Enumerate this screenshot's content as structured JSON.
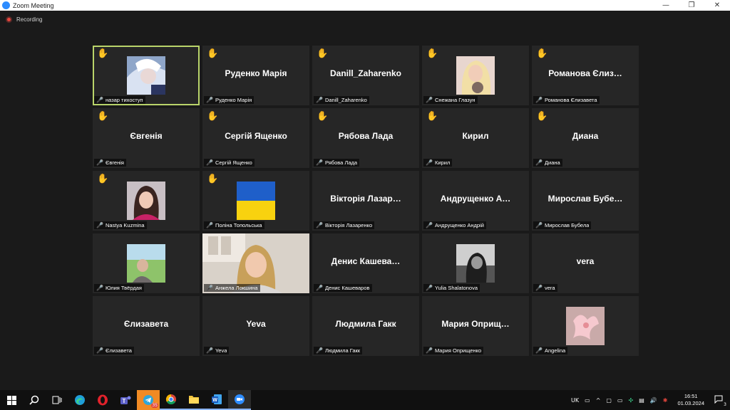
{
  "window": {
    "title": "Zoom Meeting",
    "controls": [
      "—",
      "❐",
      "✕"
    ]
  },
  "recording": {
    "label": "Recording"
  },
  "tiles": [
    {
      "big": "",
      "name": "назар тихоступ",
      "hand": true,
      "avatar": "anime-avatar",
      "active": true
    },
    {
      "big": "Руденко Марія",
      "name": "Руденко Марія",
      "hand": true
    },
    {
      "big": "Danill_Zaharenko",
      "name": "Danill_Zaharenko",
      "hand": true
    },
    {
      "big": "",
      "name": "Снежана Глазун",
      "hand": true,
      "avatar": "photo-blonde"
    },
    {
      "big": "Романова Єлиз…",
      "name": "Романова Єлизавета",
      "hand": true
    },
    {
      "big": "Євгенія",
      "name": "Євгенія",
      "hand": true
    },
    {
      "big": "Сергій Ященко",
      "name": "Сергій Ященко",
      "hand": true
    },
    {
      "big": "Рябова Лада",
      "name": "Рябова Лада",
      "hand": true
    },
    {
      "big": "Кирил",
      "name": "Кирил",
      "hand": true
    },
    {
      "big": "Диана",
      "name": "Диана",
      "hand": true
    },
    {
      "big": "",
      "name": "Nastya Kuzmina",
      "hand": true,
      "avatar": "photo-girl"
    },
    {
      "big": "",
      "name": "Поліна Топольська",
      "hand": true,
      "avatar": "ukraine-flag"
    },
    {
      "big": "Вікторія Лазар…",
      "name": "Вікторія Лазаренко",
      "hand": false
    },
    {
      "big": "Андрущенко А…",
      "name": "Андрущенко Андрій",
      "hand": false
    },
    {
      "big": "Мирослав Бубе…",
      "name": "Мирослав Бубела",
      "hand": false
    },
    {
      "big": "",
      "name": "Юлия Твёрдая",
      "hand": false,
      "avatar": "photo-outdoor"
    },
    {
      "big": "",
      "name": "Анжела Локшина",
      "hand": false,
      "avatar": "video-woman"
    },
    {
      "big": "Денис Кашева…",
      "name": "Денис Кашеваров",
      "hand": false
    },
    {
      "big": "",
      "name": "Yulia Shalatonova",
      "hand": false,
      "avatar": "photo-bw"
    },
    {
      "big": "vera",
      "name": "vera",
      "hand": false
    },
    {
      "big": "Єлизавета",
      "name": "Єлизавета",
      "hand": false
    },
    {
      "big": "Yeva",
      "name": "Yeva",
      "hand": false
    },
    {
      "big": "Людмила Гакк",
      "name": "Людмила Гакк",
      "hand": false
    },
    {
      "big": "Мария Оприщ…",
      "name": "Мария Оприщенко",
      "hand": false
    },
    {
      "big": "",
      "name": "Angelina",
      "hand": false,
      "avatar": "photo-flower"
    }
  ],
  "taskbar": {
    "items": [
      "windows-icon",
      "search-icon",
      "task-view-icon",
      "edge-icon",
      "opera-icon",
      "teams-icon",
      "telegram-icon",
      "chrome-icon",
      "file-explorer-icon",
      "word-icon",
      "zoom-icon"
    ],
    "telegram_badge": "35",
    "lang": "UK",
    "time": "16:51",
    "date": "01.03.2024",
    "notifications": "3"
  },
  "colors": {
    "tile_bg": "#262626",
    "active_outline": "#b9d46a",
    "hand": "#f2b83a",
    "muted": "#e0453c",
    "zoom_blue": "#2d8cff"
  }
}
